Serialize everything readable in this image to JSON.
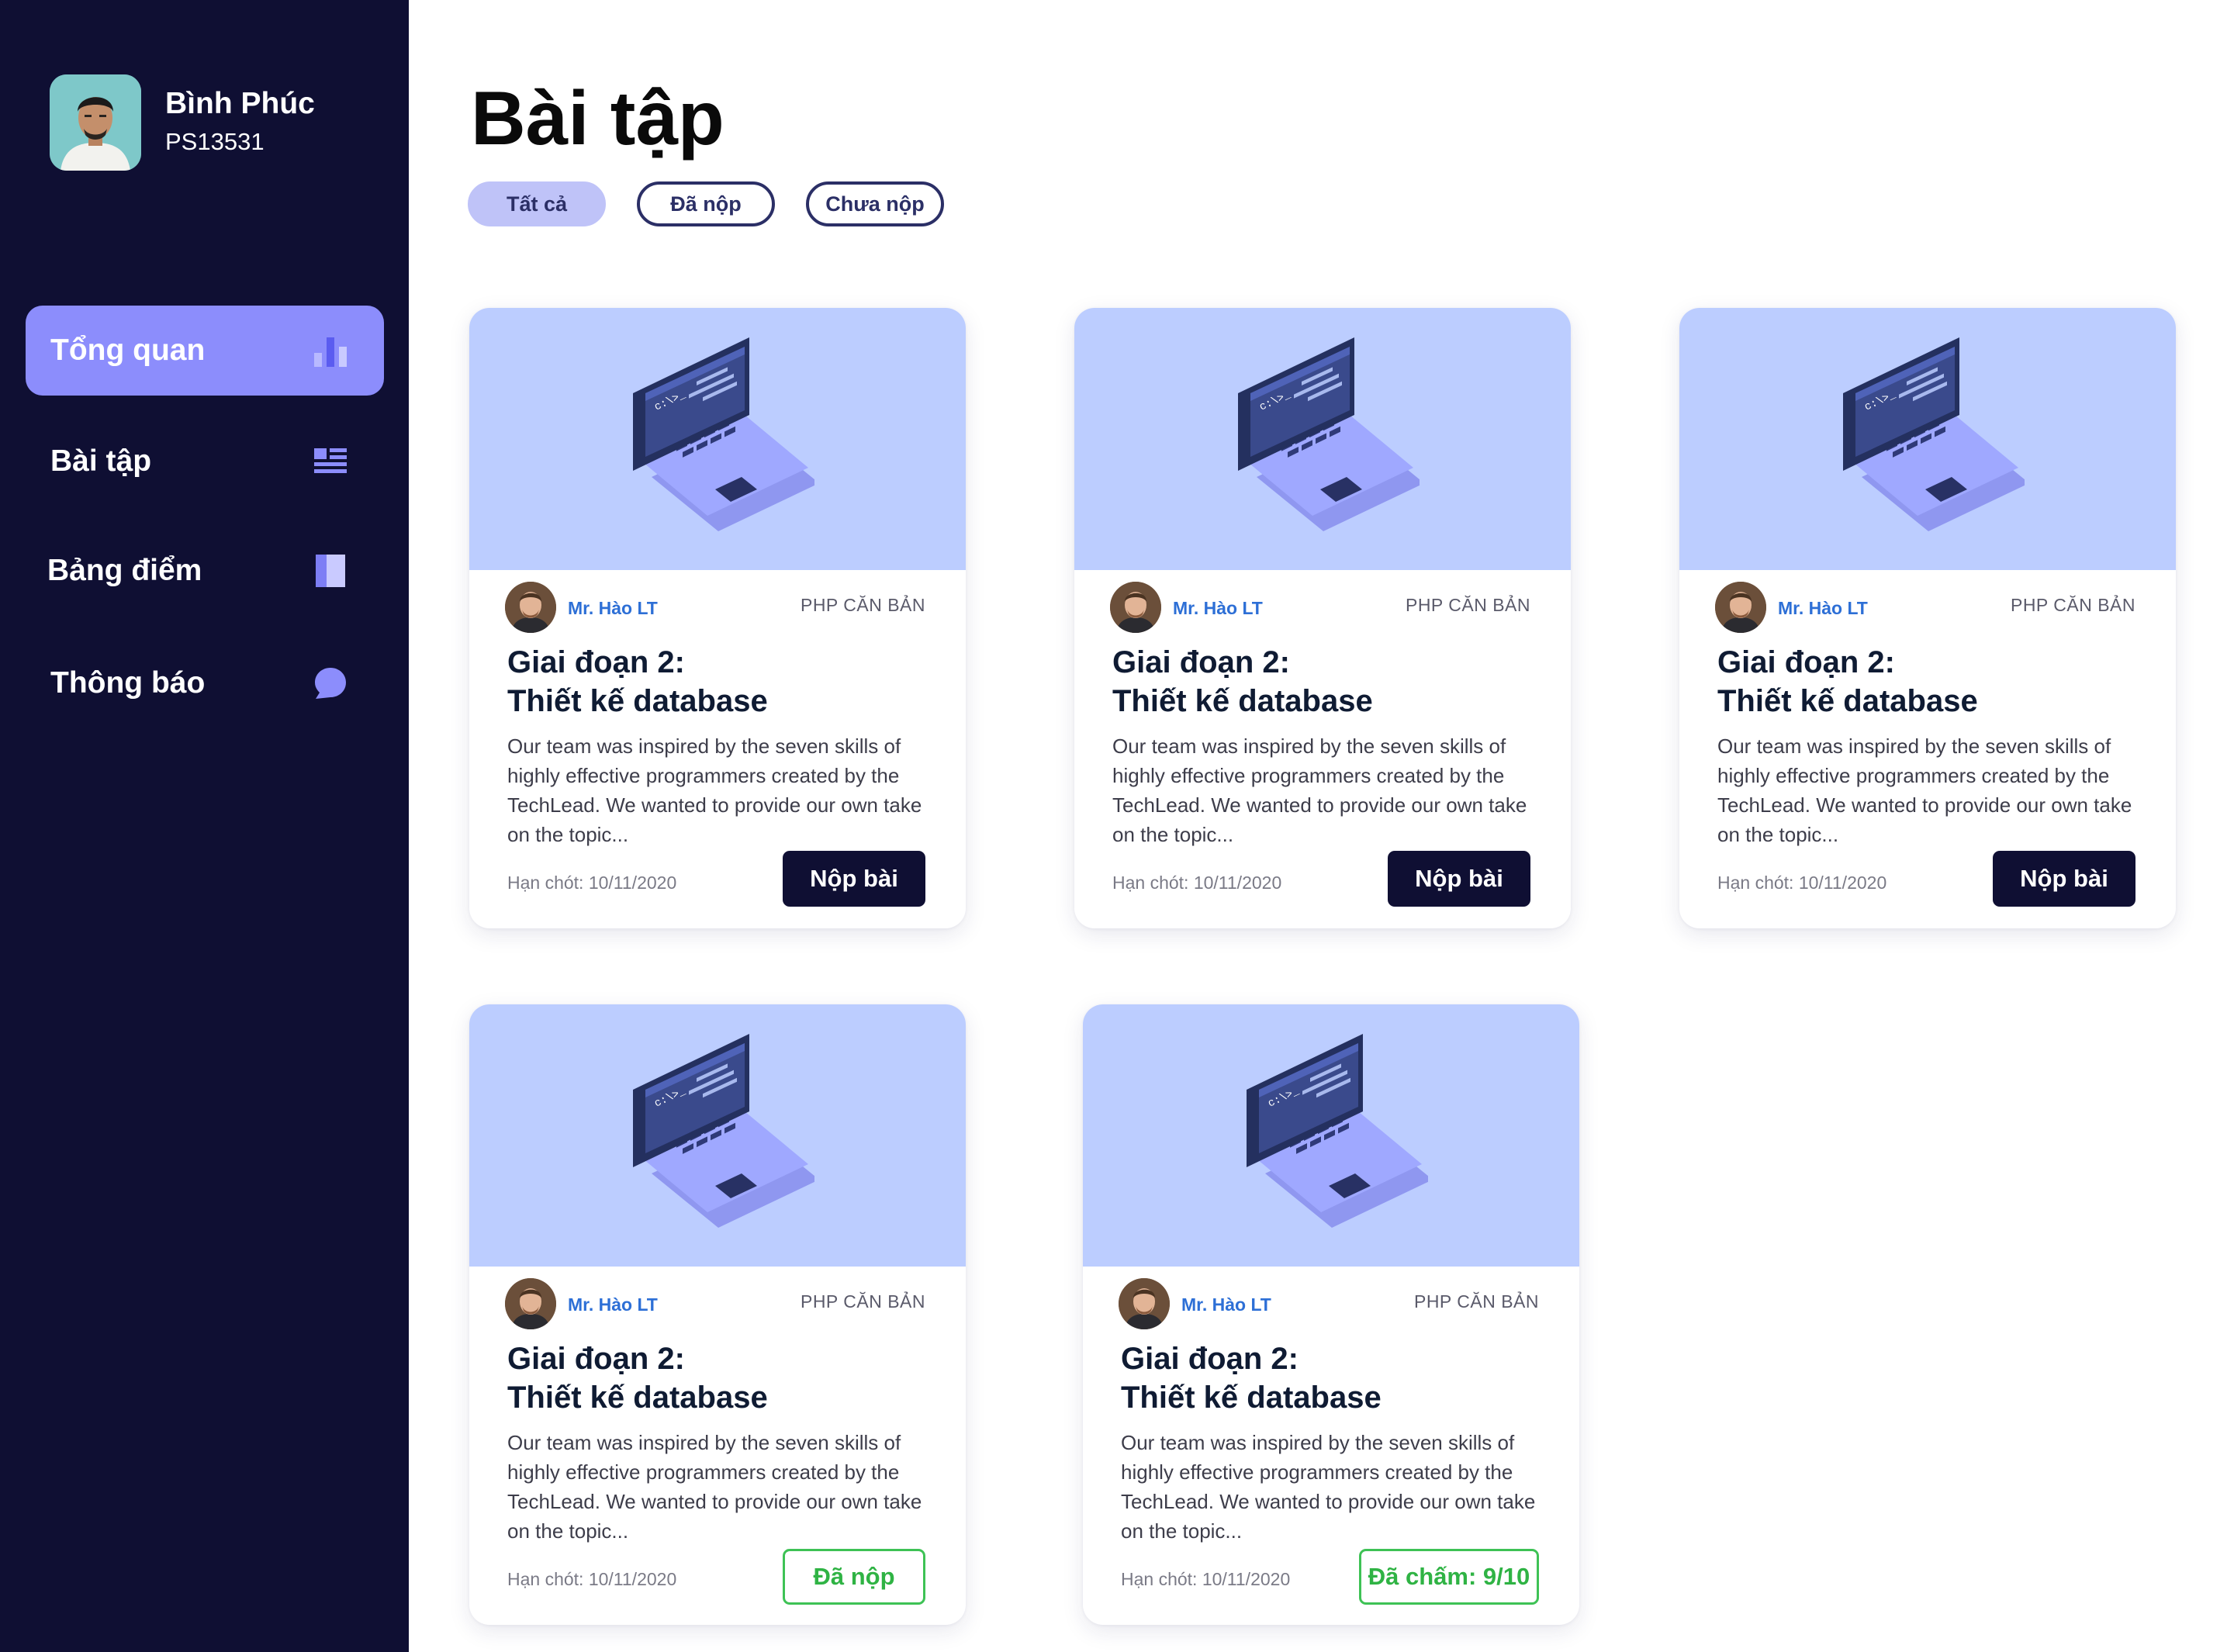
{
  "user": {
    "name": "Bình Phúc",
    "id": "PS13531"
  },
  "nav": [
    {
      "label": "Tổng quan",
      "icon": "bar-chart-icon",
      "active": true
    },
    {
      "label": "Bài tập",
      "icon": "list-icon",
      "active": false
    },
    {
      "label": "Bảng điểm",
      "icon": "book-icon",
      "active": false
    },
    {
      "label": "Thông báo",
      "icon": "chat-bubble-icon",
      "active": false
    }
  ],
  "page": {
    "title": "Bài tập"
  },
  "filters": [
    {
      "label": "Tất cả",
      "active": true
    },
    {
      "label": "Đã nộp",
      "active": false
    },
    {
      "label": "Chưa nộp",
      "active": false
    }
  ],
  "cards": [
    {
      "teacher": "Mr. Hào LT",
      "subject": "PHP CĂN BẢN",
      "title_line1": "Giai đoạn 2:",
      "title_line2": "Thiết kế database",
      "description": "Our team was inspired by the seven skills of highly effective programmers created by the TechLead. We wanted to provide our own take on the topic...",
      "screen_text": "c:\\>_",
      "deadline": "Hạn chót: 10/11/2020",
      "action": "Nộp bài",
      "status": "pending"
    },
    {
      "teacher": "Mr. Hào LT",
      "subject": "PHP CĂN BẢN",
      "title_line1": "Giai đoạn 2:",
      "title_line2": "Thiết kế database",
      "description": "Our team was inspired by the seven skills of highly effective programmers created by the TechLead. We wanted to provide our own take on the topic...",
      "screen_text": "c:\\>_",
      "deadline": "Hạn chót: 10/11/2020",
      "action": "Nộp bài",
      "status": "pending"
    },
    {
      "teacher": "Mr. Hào LT",
      "subject": "PHP CĂN BẢN",
      "title_line1": "Giai đoạn 2:",
      "title_line2": "Thiết kế database",
      "description": "Our team was inspired by the seven skills of highly effective programmers created by the TechLead. We wanted to provide our own take on the topic...",
      "screen_text": "c:\\>_",
      "deadline": "Hạn chót: 10/11/2020",
      "action": "Nộp bài",
      "status": "pending"
    },
    {
      "teacher": "Mr. Hào LT",
      "subject": "PHP CĂN BẢN",
      "title_line1": "Giai đoạn 2:",
      "title_line2": "Thiết kế database",
      "description": "Our team was inspired by the seven skills of highly effective programmers created by the TechLead. We wanted to provide our own take on the topic...",
      "screen_text": "c:\\>_",
      "deadline": "Hạn chót: 10/11/2020",
      "action": "Đã nộp",
      "status": "submitted"
    },
    {
      "teacher": "Mr. Hào LT",
      "subject": "PHP CĂN BẢN",
      "title_line1": "Giai đoạn 2:",
      "title_line2": "Thiết kế database",
      "description": "Our team was inspired by the seven skills of highly effective programmers created by the TechLead. We wanted to provide our own take on the topic...",
      "screen_text": "c:\\>_",
      "deadline": "Hạn chót: 10/11/2020",
      "action": "Đã chấm: 9/10",
      "status": "graded"
    }
  ],
  "colors": {
    "sidebar_bg": "#0f0f33",
    "nav_active": "#8c8dfc",
    "icon_accent": "#8c8dfc",
    "card_hero": "#bccdff",
    "button_dark": "#0f0f33",
    "status_green": "#3ec255",
    "teacher_link": "#2d6fd6"
  }
}
